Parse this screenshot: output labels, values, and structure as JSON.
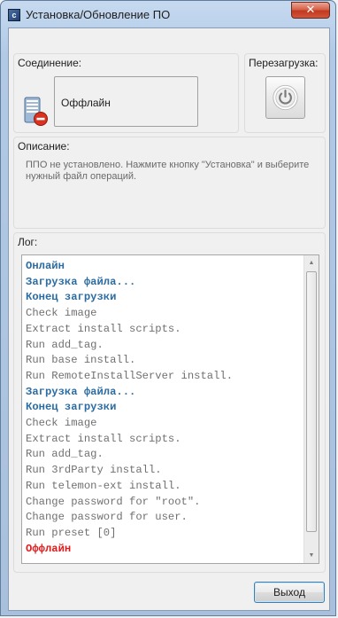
{
  "window": {
    "title": "Установка/Обновление ПО",
    "close_label": "✕",
    "app_icon_glyph": "c"
  },
  "connection": {
    "label": "Соединение:",
    "status": "Оффлайн",
    "icon": "server-offline-icon"
  },
  "reboot": {
    "label": "Перезагрузка:",
    "icon": "power-icon"
  },
  "description": {
    "label": "Описание:",
    "text": "ППО не установлено. Нажмите кнопку \"Установка\" и выберите нужный файл операций."
  },
  "log": {
    "label": "Лог:",
    "lines": [
      {
        "text": "Онлайн",
        "style": "info"
      },
      {
        "text": "Загрузка файла...",
        "style": "info"
      },
      {
        "text": "Конец загрузки",
        "style": "info"
      },
      {
        "text": "Check image",
        "style": "normal"
      },
      {
        "text": "Extract install scripts.",
        "style": "normal"
      },
      {
        "text": "Run add_tag.",
        "style": "normal"
      },
      {
        "text": "Run base install.",
        "style": "normal"
      },
      {
        "text": "Run RemoteInstallServer install.",
        "style": "normal"
      },
      {
        "text": "Загрузка файла...",
        "style": "info"
      },
      {
        "text": "Конец загрузки",
        "style": "info"
      },
      {
        "text": "Check image",
        "style": "normal"
      },
      {
        "text": "Extract install scripts.",
        "style": "normal"
      },
      {
        "text": "Run add_tag.",
        "style": "normal"
      },
      {
        "text": "Run 3rdParty install.",
        "style": "normal"
      },
      {
        "text": "Run telemon-ext install.",
        "style": "normal"
      },
      {
        "text": "Change password for \"root\".",
        "style": "normal"
      },
      {
        "text": "Change password for user.",
        "style": "normal"
      },
      {
        "text": "Run preset [0]",
        "style": "normal"
      },
      {
        "text": "Оффлайн",
        "style": "error"
      }
    ],
    "scroll_up_glyph": "▲",
    "scroll_down_glyph": "▼"
  },
  "colors": {
    "info": "#2b6ca3",
    "error": "#e01b1b",
    "normal": "#707070"
  },
  "buttons": {
    "exit_label": "Выход"
  }
}
